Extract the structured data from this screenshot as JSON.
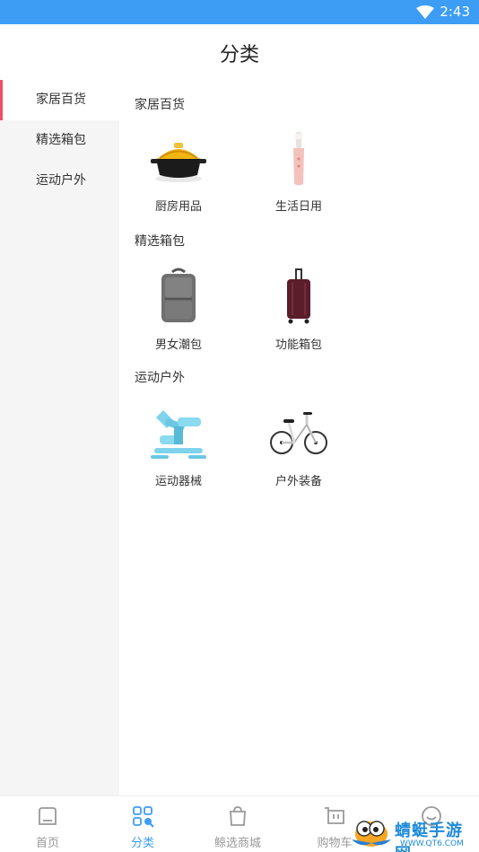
{
  "status_bar": {
    "time": "2:43",
    "wifi_icon": "wifi-icon"
  },
  "header": {
    "title": "分类"
  },
  "sidebar": {
    "items": [
      {
        "label": "家居百货",
        "active": true
      },
      {
        "label": "精选箱包",
        "active": false
      },
      {
        "label": "运动户外",
        "active": false
      }
    ]
  },
  "sections": [
    {
      "title": "家居百货",
      "products": [
        {
          "label": "厨房用品",
          "icon": "casserole-pot-image"
        },
        {
          "label": "生活日用",
          "icon": "electric-toothbrush-image"
        }
      ]
    },
    {
      "title": "精选箱包",
      "products": [
        {
          "label": "男女潮包",
          "icon": "backpack-image"
        },
        {
          "label": "功能箱包",
          "icon": "suitcase-image"
        }
      ]
    },
    {
      "title": "运动户外",
      "products": [
        {
          "label": "运动器械",
          "icon": "stepper-machine-image"
        },
        {
          "label": "户外装备",
          "icon": "folding-bicycle-image"
        }
      ]
    }
  ],
  "tabbar": {
    "items": [
      {
        "label": "首页",
        "icon": "home-icon",
        "active": false
      },
      {
        "label": "分类",
        "icon": "category-grid-icon",
        "active": true
      },
      {
        "label": "鲸选商城",
        "icon": "shopping-bag-icon",
        "active": false
      },
      {
        "label": "购物车",
        "icon": "cart-icon",
        "active": false
      },
      {
        "label": "",
        "icon": "profile-icon",
        "active": false
      }
    ]
  },
  "watermark": {
    "main": "蜻蜓手游网",
    "sub": "WWW.QT6.COM"
  },
  "colors": {
    "accent": "#3d9df5",
    "active_indicator": "#f05068",
    "sidebar_bg": "#f5f5f5"
  }
}
